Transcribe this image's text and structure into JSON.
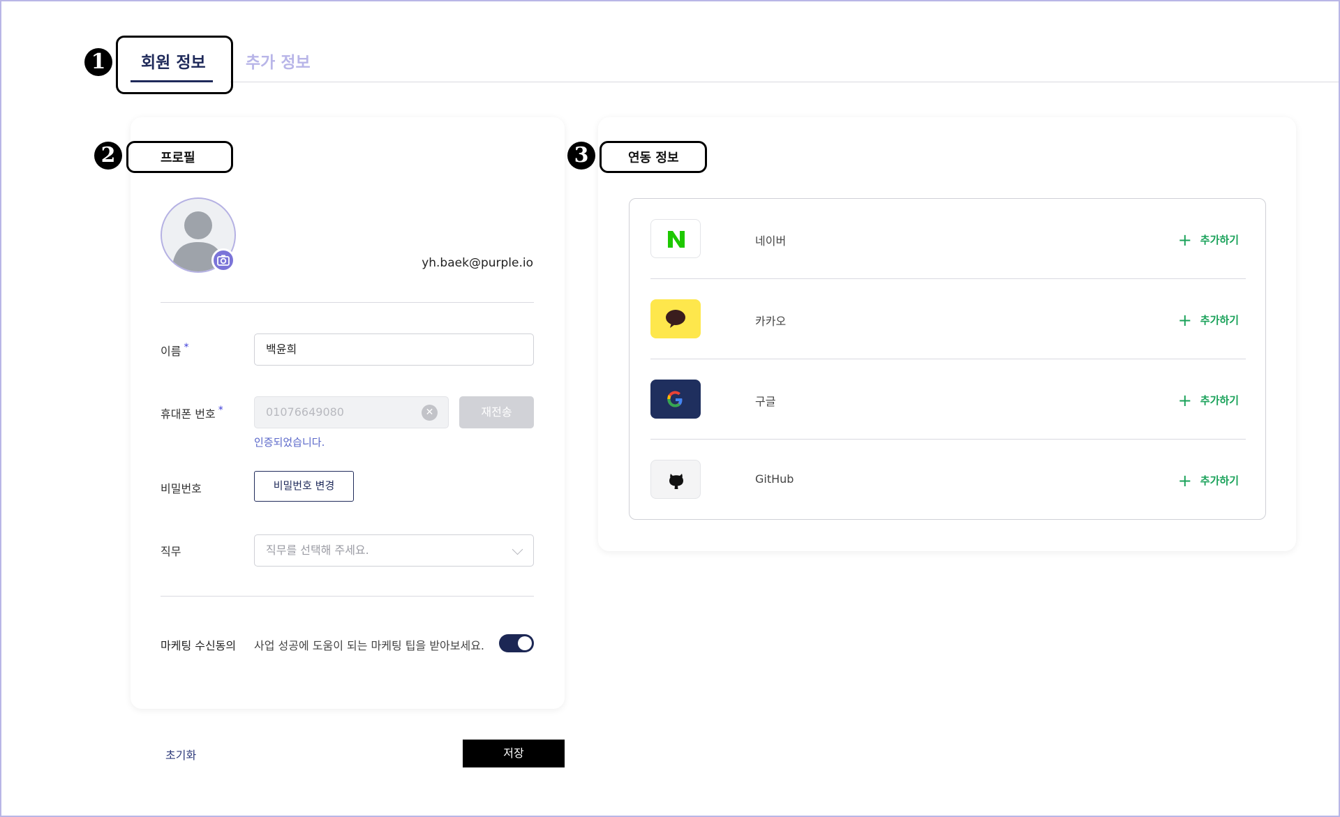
{
  "tabs": {
    "member_info": "회원 정보",
    "extra_info": "추가 정보"
  },
  "annotations": [
    "1",
    "2",
    "3"
  ],
  "profile": {
    "section_title": "프로필",
    "email": "yh.baek@purple.io",
    "name_label": "이름",
    "required_mark": "*",
    "name_value": "백윤희",
    "phone_label": "휴대폰 번호",
    "phone_value": "01076649080",
    "resend_label": "재전송",
    "verified_text": "인증되었습니다.",
    "password_label": "비밀번호",
    "password_button": "비밀번호 변경",
    "job_label": "직무",
    "job_placeholder": "직무를 선택해 주세요.",
    "marketing_label": "마케팅 수신동의",
    "marketing_desc": "사업 성공에 도움이 되는 마케팅 팁을 받아보세요.",
    "marketing_enabled": true
  },
  "footer": {
    "reset_label": "초기화",
    "save_label": "저장"
  },
  "linked": {
    "section_title": "연동 정보",
    "add_label": "추가하기",
    "accounts": [
      {
        "name": "네이버",
        "icon": "naver-icon",
        "bg": "#ffffff",
        "fg": "#1ec800"
      },
      {
        "name": "카카오",
        "icon": "kakao-icon",
        "bg": "#fee74c",
        "fg": "#3a1d1d"
      },
      {
        "name": "구글",
        "icon": "google-icon",
        "bg": "#1f2f5e",
        "fg": "#ea4335"
      },
      {
        "name": "GitHub",
        "icon": "github-icon",
        "bg": "#f4f4f5",
        "fg": "#111111"
      }
    ]
  },
  "colors": {
    "primary": "#1f2a5a",
    "accent": "#7b74d8",
    "success": "#1aa25a"
  }
}
